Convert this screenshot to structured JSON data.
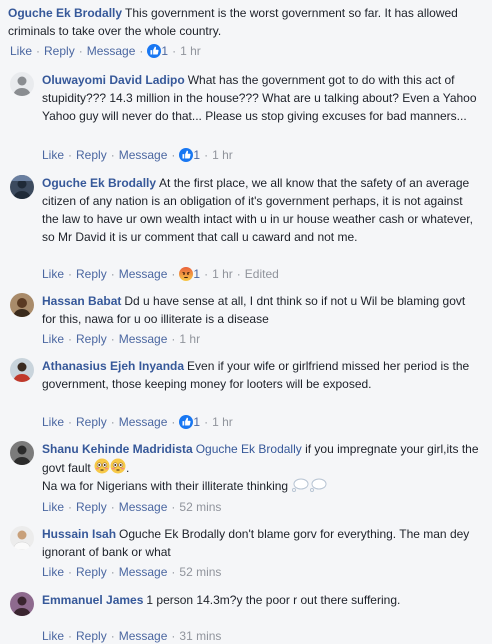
{
  "comments": [
    {
      "author": "Oguche Ek Brodally",
      "text": "This government is the worst government so far. It has allowed criminals to take over the whole country.",
      "like": "Like",
      "reply": "Reply",
      "message": "Message",
      "reaction_count": "1",
      "time": "1 hr",
      "reaction_icon": "like-icon",
      "avatar_color": "#2e3a4b"
    },
    {
      "author": "Oluwayomi David Ladipo",
      "text": "What has the government got to do with this act of stupidity??? 14.3 million in the house??? What are u talking about? Even a Yahoo Yahoo guy will never do that... Please us stop giving excuses for bad manners...",
      "like": "Like",
      "reply": "Reply",
      "message": "Message",
      "reaction_count": "1",
      "time": "1 hr",
      "reaction_icon": "like-icon",
      "avatar_color": "#e9ebee"
    },
    {
      "author": "Oguche Ek Brodally",
      "text": "At the first place, we all know that the safety of an average citizen of any nation is an obligation of it's government perhaps, it is not against the law to have ur own wealth intact with u in ur house weather cash or whatever, so Mr David it is ur comment that call u caward and not me.",
      "like": "Like",
      "reply": "Reply",
      "message": "Message",
      "reaction_count": "1",
      "time": "1 hr",
      "edited": "Edited",
      "reaction_icon": "angry-icon",
      "avatar_color": "#2e3a4b"
    },
    {
      "author": "Hassan Babat",
      "text": "Dd u have sense at all, I dnt think so if not u Wil be blaming govt for this, nawa for u oo illiterate is a disease",
      "like": "Like",
      "reply": "Reply",
      "message": "Message",
      "time": "1 hr",
      "avatar_color": "#6b4a2e"
    },
    {
      "author": "Athanasius Ejeh Inyanda",
      "text": "Even if your wife or girlfriend missed her period is the government, those keeping money for looters will be exposed.",
      "like": "Like",
      "reply": "Reply",
      "message": "Message",
      "reaction_count": "1",
      "time": "1 hr",
      "reaction_icon": "like-icon",
      "avatar_color": "#c0392b"
    },
    {
      "author": "Shanu Kehinde Madridista",
      "mention": "Oguche Ek Brodally",
      "text_line1": "if you impregnate your girl,its the govt fault",
      "text_line2": "Na wa for Nigerians with their illiterate thinking",
      "like": "Like",
      "reply": "Reply",
      "message": "Message",
      "time": "52 mins",
      "emoji": "flushed-face-icon",
      "bubble": "thought-bubble-icon",
      "avatar_color": "#4a4a4a"
    },
    {
      "author": "Hussain Isah",
      "text": "Oguche Ek Brodally don't blame gorv for everything. The man dey ignorant of bank or what",
      "like": "Like",
      "reply": "Reply",
      "message": "Message",
      "time": "52 mins",
      "avatar_color": "#d9d9d9"
    },
    {
      "author": "Emmanuel James",
      "text": "1 person 14.3m?y the poor r out there suffering.",
      "like": "Like",
      "reply": "Reply",
      "message": "Message",
      "time": "31 mins",
      "avatar_color": "#5a3e5a"
    }
  ],
  "colors": {
    "link": "#365899",
    "action_link": "#4b67a1",
    "meta": "#90949c",
    "background": "#f5f6f8",
    "like_blue": "#1877f2"
  }
}
